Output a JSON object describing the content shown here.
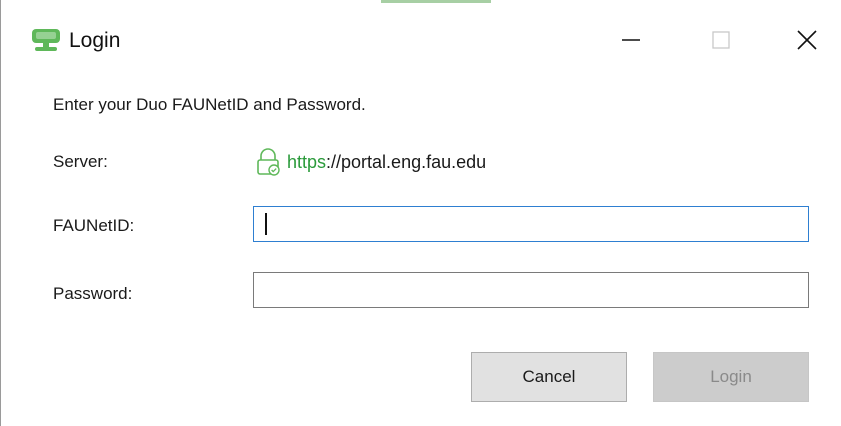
{
  "window": {
    "title": "Login",
    "controls": {
      "minimize": "minimize",
      "maximize": "maximize",
      "close": "close"
    }
  },
  "form": {
    "prompt": "Enter your Duo FAUNetID and Password.",
    "server_label": "Server:",
    "server_scheme": "https",
    "server_rest": "://portal.eng.fau.edu",
    "netid_label": "FAUNetID:",
    "netid_value": "",
    "password_label": "Password:",
    "password_value": ""
  },
  "buttons": {
    "cancel": "Cancel",
    "login": "Login",
    "login_enabled": false
  },
  "colors": {
    "brand_green": "#5fb85a",
    "secure_green": "#2a9a3a",
    "focus_blue": "#2e7fd1"
  },
  "icons": {
    "app": "monitor-icon",
    "lock": "secure-lock-icon"
  }
}
